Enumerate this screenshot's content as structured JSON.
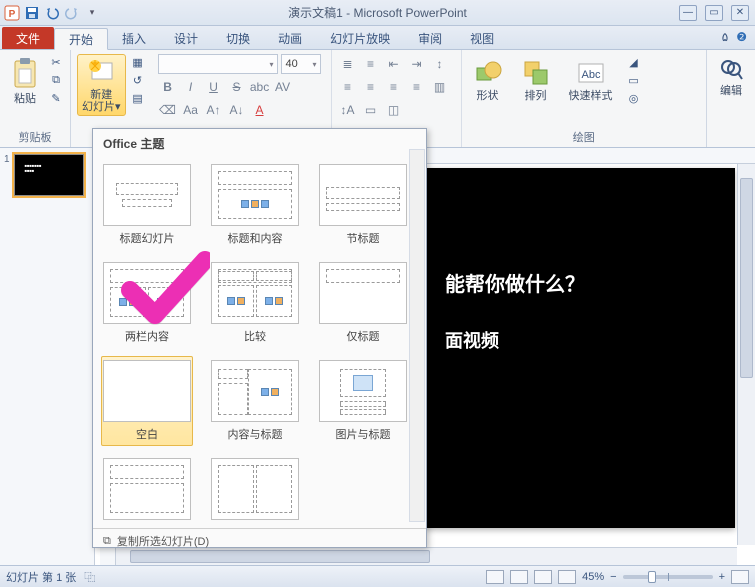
{
  "titlebar": {
    "doc_title": "演示文稿1 - Microsoft PowerPoint"
  },
  "tabs": {
    "file": "文件",
    "items": [
      "开始",
      "插入",
      "设计",
      "切换",
      "动画",
      "幻灯片放映",
      "审阅",
      "视图"
    ],
    "active_index": 0
  },
  "ribbon": {
    "clipboard": {
      "paste": "粘贴",
      "group_label": "剪贴板"
    },
    "slides": {
      "new_slide_l1": "新建",
      "new_slide_l2": "幻灯片"
    },
    "font": {
      "family": "",
      "size": "40"
    },
    "drawing": {
      "shapes": "形状",
      "arrange": "排列",
      "quick_styles": "快速样式",
      "group_label": "绘图"
    },
    "editing": {
      "label": "编辑"
    }
  },
  "layout_dropdown": {
    "header": "Office 主题",
    "items": [
      "标题幻灯片",
      "标题和内容",
      "节标题",
      "两栏内容",
      "比较",
      "仅标题",
      "空白",
      "内容与标题",
      "图片与标题"
    ],
    "selected_index": 6,
    "footer": "复制所选幻灯片(D)"
  },
  "slide": {
    "line1": "能帮你做什么？",
    "line2": "面视频"
  },
  "thumbnails": {
    "items": [
      {
        "num": "1",
        "preview_l1": "■■■■■■■",
        "preview_l2": "■■■■"
      }
    ]
  },
  "statusbar": {
    "slide_info": "幻灯片 第 1 张",
    "zoom_pct": "45%"
  }
}
